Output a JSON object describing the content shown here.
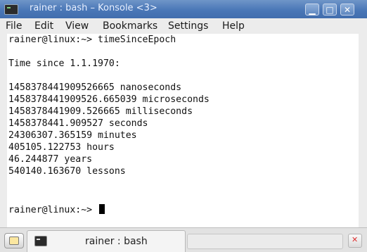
{
  "window": {
    "title": "rainer : bash – Konsole <3>",
    "icons": {
      "app": "terminal-icon",
      "minimize": "minimize-icon",
      "maximize": "maximize-icon",
      "close": "close-icon"
    },
    "buttons": {
      "minimize": "▁",
      "maximize": "□",
      "close": "✕"
    }
  },
  "menubar": {
    "items": [
      "File",
      "Edit",
      "View",
      "Bookmarks",
      "Settings",
      "Help"
    ]
  },
  "terminal": {
    "lines": [
      "rainer@linux:~> timeSinceEpoch",
      "",
      "Time since 1.1.1970:",
      "",
      "1458378441909526665 nanoseconds",
      "1458378441909526.665039 microseconds",
      "1458378441909.526665 milliseconds",
      "1458378441.909527 seconds",
      "24306307.365159 minutes",
      "405105.122753 hours",
      "46.244877 years",
      "540140.163670 lessons",
      "",
      "rainer@linux:~> "
    ]
  },
  "tabs": {
    "new_tab_icon": "new-tab-icon",
    "items": [
      {
        "label": "rainer : bash",
        "icon": "terminal-icon"
      }
    ],
    "close_icon": "close-tab-icon"
  },
  "colors": {
    "titlebar": "#4a77b7",
    "terminal_bg": "#ffffff",
    "text": "#111111"
  }
}
